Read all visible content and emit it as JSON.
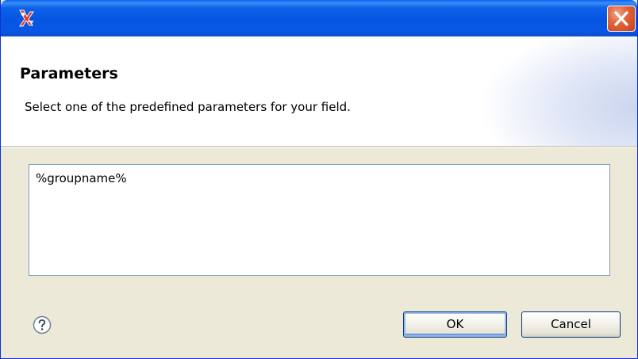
{
  "window": {
    "title": "",
    "app_icon": "app-logo-icon",
    "close_icon": "close-icon"
  },
  "header": {
    "title": "Parameters",
    "description": "Select one of the predefined parameters for your field."
  },
  "parameters": {
    "items": [
      "%groupname%"
    ]
  },
  "footer": {
    "help_icon": "help-icon",
    "ok_label": "OK",
    "cancel_label": "Cancel"
  },
  "colors": {
    "titlebar": "#0555e0",
    "close_button": "#e2643a",
    "dialog_bg": "#ece9d8",
    "list_border": "#7f9db9"
  }
}
